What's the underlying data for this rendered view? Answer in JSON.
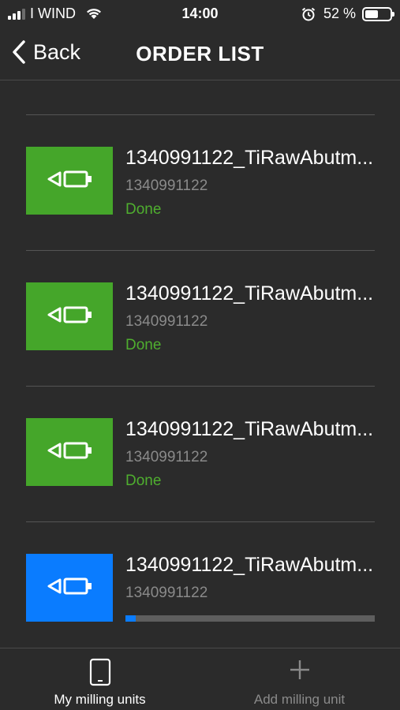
{
  "status_bar": {
    "carrier": "I WIND",
    "time": "14:00",
    "battery_text": "52 %",
    "battery_level": 0.52,
    "icons": [
      "signal-icon",
      "wifi-icon",
      "alarm-icon",
      "battery-icon"
    ]
  },
  "nav": {
    "back_label": "Back",
    "title": "ORDER LIST"
  },
  "colors": {
    "background": "#2b2b2b",
    "done_thumb": "#45a62a",
    "in_progress_thumb": "#0a7cff",
    "done_text": "#4fae2f",
    "progress_fill": "#0a7cff",
    "divider": "#555555"
  },
  "orders": [
    {
      "title": "1340991122_TiRawAbutm...",
      "id": "1340991122",
      "status": "Done",
      "state": "done",
      "icon": "abutment-icon"
    },
    {
      "title": "1340991122_TiRawAbutm...",
      "id": "1340991122",
      "status": "Done",
      "state": "done",
      "icon": "abutment-icon"
    },
    {
      "title": "1340991122_TiRawAbutm...",
      "id": "1340991122",
      "status": "Done",
      "state": "done",
      "icon": "abutment-icon"
    },
    {
      "title": "1340991122_TiRawAbutm...",
      "id": "1340991122",
      "status": "",
      "state": "in-progress",
      "progress": 0.04,
      "icon": "abutment-icon"
    }
  ],
  "tabs": [
    {
      "label": "My milling units",
      "icon": "tablet-icon",
      "active": true
    },
    {
      "label": "Add milling unit",
      "icon": "plus-icon",
      "active": false
    }
  ]
}
